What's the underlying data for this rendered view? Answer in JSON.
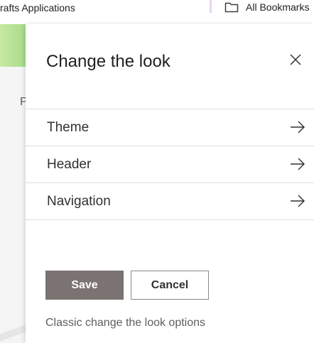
{
  "bookmarks_bar": {
    "left_item_label": "rafts Applications",
    "folder_icon": "folder-icon",
    "folder_label": "All Bookmarks"
  },
  "background_page": {
    "partial_letter": "P"
  },
  "panel": {
    "title": "Change the look",
    "close_icon": "close-icon",
    "options": [
      {
        "label": "Theme",
        "icon": "arrow-right-icon"
      },
      {
        "label": "Header",
        "icon": "arrow-right-icon"
      },
      {
        "label": "Navigation",
        "icon": "arrow-right-icon"
      }
    ],
    "save_label": "Save",
    "cancel_label": "Cancel",
    "classic_link": "Classic change the look options"
  },
  "colors": {
    "save_button_bg": "#7b7371",
    "header_gradient": "#a8dc8c",
    "text_primary": "#201f1e",
    "text_secondary": "#605e5c",
    "divider": "#e1dfdd"
  }
}
